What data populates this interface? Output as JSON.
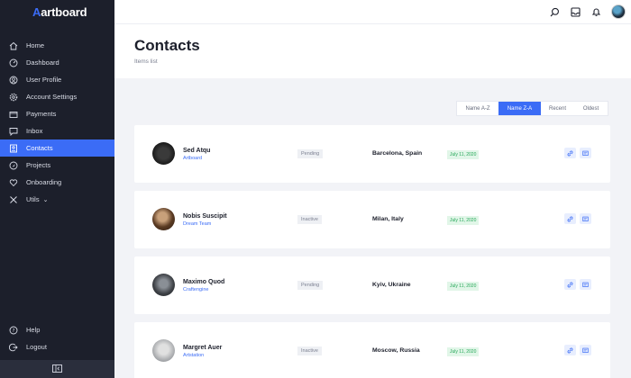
{
  "brand": {
    "name": "artboard",
    "logo_letter": "A"
  },
  "sidebar": {
    "items": [
      {
        "label": "Home",
        "icon": "home-icon"
      },
      {
        "label": "Dashboard",
        "icon": "gauge-icon"
      },
      {
        "label": "User Profile",
        "icon": "user-icon"
      },
      {
        "label": "Account Settings",
        "icon": "gear-icon"
      },
      {
        "label": "Payments",
        "icon": "wallet-icon"
      },
      {
        "label": "Inbox",
        "icon": "chat-icon"
      },
      {
        "label": "Contacts",
        "icon": "contact-icon",
        "active": true
      },
      {
        "label": "Projects",
        "icon": "rocket-icon"
      },
      {
        "label": "Onboarding",
        "icon": "heart-icon"
      },
      {
        "label": "Utils",
        "icon": "tools-icon"
      }
    ],
    "bottom": [
      {
        "label": "Help",
        "icon": "help-icon"
      },
      {
        "label": "Logout",
        "icon": "logout-icon"
      }
    ]
  },
  "header": {
    "title": "Contacts",
    "subtitle": "Items list"
  },
  "sort_tabs": [
    "Name A-Z",
    "Name Z-A",
    "Recent",
    "Oldest"
  ],
  "sort_active": "Name Z-A",
  "contacts": [
    {
      "name": "Sed Atqu",
      "company": "Artboard",
      "status": "Pending",
      "city": "Barcelona, Spain",
      "date": "July 11, 2020"
    },
    {
      "name": "Nobis Suscipit",
      "company": "Dream Team",
      "status": "Inactive",
      "city": "Milan, Italy",
      "date": "July 11, 2020"
    },
    {
      "name": "Maximo Quod",
      "company": "Craftengine",
      "status": "Pending",
      "city": "Kyiv, Ukraine",
      "date": "July 11, 2020"
    },
    {
      "name": "Margret Auer",
      "company": "Artstation",
      "status": "Inactive",
      "city": "Moscow, Russia",
      "date": "July 11, 2020"
    }
  ],
  "colors": {
    "accent": "#3b6cf6",
    "sidebar_bg": "#1c1f2b",
    "success": "#27a859"
  }
}
